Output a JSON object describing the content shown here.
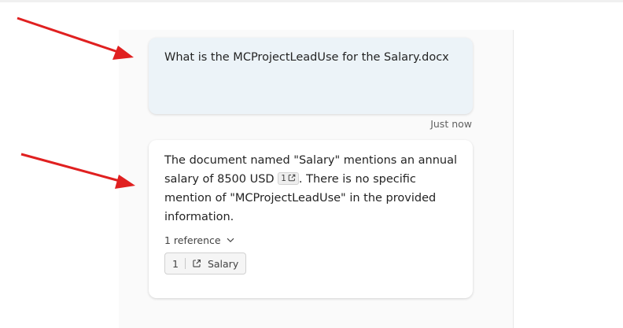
{
  "conversation": {
    "user_message": "What is the MCProjectLeadUse for the Salary.docx",
    "timestamp": "Just now",
    "bot_message": {
      "text_before_citation": "The document named \"Salary\" mentions an annual salary of 8500 USD ",
      "citation_number": "1",
      "text_after_citation": ". There is no specific mention of \"MCProjectLeadUse\" in the provided information."
    },
    "references_toggle": "1 reference",
    "reference": {
      "number": "1",
      "title": "Salary"
    }
  },
  "annotation_color": "#e02020"
}
